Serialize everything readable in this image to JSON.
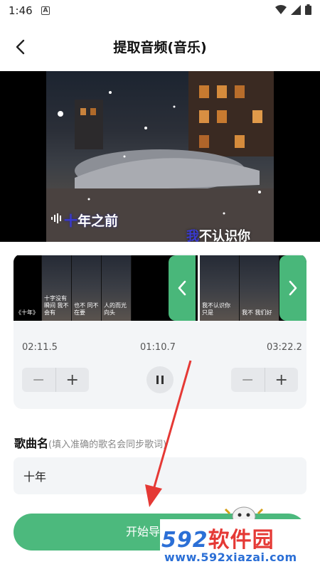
{
  "status": {
    "time": "1:46",
    "a_label": "A"
  },
  "header": {
    "title": "提取音频(音乐)"
  },
  "video": {
    "lyric_top": {
      "highlight": "十",
      "rest": "年之前"
    },
    "lyric_bottom": {
      "highlight": "我",
      "rest": "不认识你"
    }
  },
  "thumbs": [
    {
      "cap": "《十年》"
    },
    {
      "cap": "十字没有瞬间 我不会有"
    },
    {
      "cap": "也不 同不在要"
    },
    {
      "cap": "人的而光 向头"
    },
    {
      "cap": "我不认识你 只是"
    },
    {
      "cap": "我不 我们好"
    }
  ],
  "panel": {
    "time_start": "02:11.5",
    "time_mid": "01:10.7",
    "time_end": "03:22.2",
    "minus": "−",
    "plus": "+"
  },
  "song": {
    "label": "歌曲名",
    "hint": "(填入准确的歌名会同步歌词)",
    "value": "十年"
  },
  "export": {
    "label": "开始导出音频"
  },
  "watermark": {
    "brand_num": "592",
    "brand_cn": "软件园",
    "url": "www.592xiazai.com"
  },
  "colors": {
    "accent": "#4cb97d",
    "nav": "#49b77a"
  }
}
